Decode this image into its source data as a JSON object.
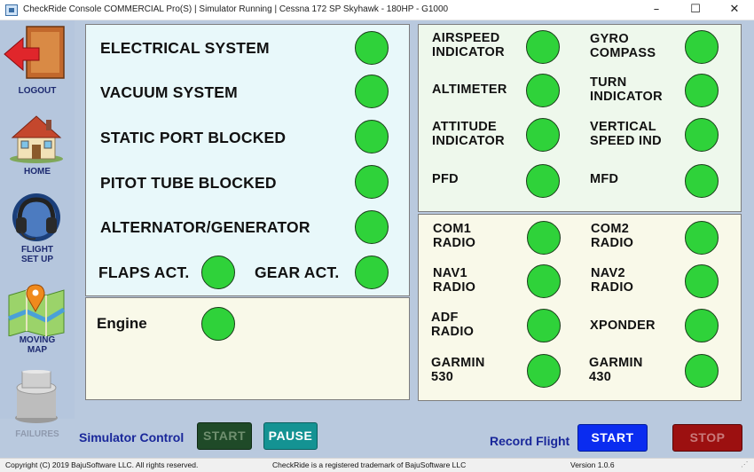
{
  "window": {
    "title": "CheckRide Console COMMERCIAL Pro(S) | Simulator Running | Cessna 172 SP Skyhawk - 180HP - G1000",
    "minimize": "–",
    "maximize": "☐",
    "close": "✕"
  },
  "sidebar": {
    "items": [
      {
        "label": "LOGOUT",
        "icon": "logout-door-arrow-icon"
      },
      {
        "label": "HOME",
        "icon": "house-icon"
      },
      {
        "label": "FLIGHT SET UP",
        "line1": "FLIGHT",
        "line2": "SET UP",
        "icon": "headset-icon"
      },
      {
        "label": "MOVING MAP",
        "line1": "MOVING",
        "line2": "MAP",
        "icon": "map-pin-icon"
      },
      {
        "label": "FAILURES",
        "icon": "failures-knob-icon",
        "disabled": true
      }
    ]
  },
  "systems_panel": {
    "rows": [
      "ELECTRICAL SYSTEM",
      "VACUUM SYSTEM",
      "STATIC PORT BLOCKED",
      "PITOT TUBE BLOCKED",
      "ALTERNATOR/GENERATOR"
    ],
    "flaps": "FLAPS ACT.",
    "gear": "GEAR ACT."
  },
  "engine_panel": {
    "label": "Engine"
  },
  "instruments_panel": {
    "left": [
      {
        "line1": "AIRSPEED",
        "line2": "INDICATOR"
      },
      {
        "line1": "ALTIMETER",
        "line2": ""
      },
      {
        "line1": "ATTITUDE",
        "line2": "INDICATOR"
      },
      {
        "line1": "PFD",
        "line2": ""
      }
    ],
    "right": [
      {
        "line1": "GYRO",
        "line2": "COMPASS"
      },
      {
        "line1": "TURN",
        "line2": "INDICATOR"
      },
      {
        "line1": "VERTICAL",
        "line2": "SPEED IND"
      },
      {
        "line1": "MFD",
        "line2": ""
      }
    ]
  },
  "radios_panel": {
    "left": [
      {
        "line1": "COM1",
        "line2": "RADIO"
      },
      {
        "line1": "NAV1",
        "line2": "RADIO"
      },
      {
        "line1": "ADF",
        "line2": "RADIO"
      },
      {
        "line1": "GARMIN",
        "line2": "530"
      }
    ],
    "right": [
      {
        "line1": "COM2",
        "line2": "RADIO"
      },
      {
        "line1": "NAV2",
        "line2": "RADIO"
      },
      {
        "line1": "XPONDER",
        "line2": ""
      },
      {
        "line1": "GARMIN",
        "line2": "430"
      }
    ]
  },
  "status_colors": {
    "ok_lamp": "#2fd23a"
  },
  "controls": {
    "simulator_label": "Simulator Control",
    "sim_start": "START",
    "sim_pause": "PAUSE",
    "record_label": "Record Flight",
    "rec_start": "START",
    "rec_stop": "STOP"
  },
  "statusbar": {
    "copyright": "Copyright (C) 2019 BajuSoftware LLC. All rights reserved.",
    "trademark": "CheckRide is a registered trademark of BajuSoftware LLC",
    "version": "Version 1.0.6"
  }
}
